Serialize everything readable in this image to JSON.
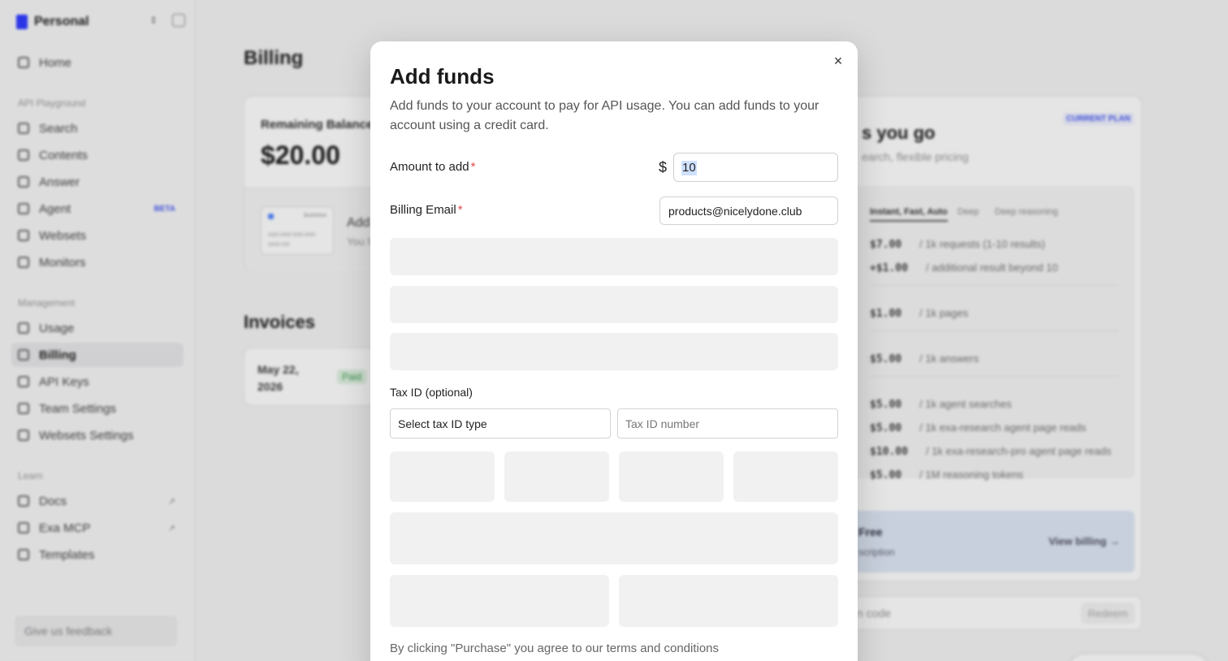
{
  "sidebar": {
    "workspace": "Personal",
    "items": [
      {
        "label": "Home"
      },
      {
        "label": "Search"
      },
      {
        "label": "Contents"
      },
      {
        "label": "Answer"
      },
      {
        "label": "Agent",
        "badge": "BETA"
      },
      {
        "label": "Websets"
      },
      {
        "label": "Monitors"
      },
      {
        "label": "Usage"
      },
      {
        "label": "Billing",
        "active": true
      },
      {
        "label": "API Keys"
      },
      {
        "label": "Team Settings"
      },
      {
        "label": "Websets Settings"
      },
      {
        "label": "Docs",
        "external": "↗"
      },
      {
        "label": "Exa MCP",
        "external": "↗"
      },
      {
        "label": "Templates"
      }
    ],
    "sections": {
      "playground": "API Playground",
      "management": "Management",
      "learn": "Learn"
    },
    "feedback": "Give us feedback"
  },
  "billing": {
    "title": "Billing",
    "balance_label": "Remaining Balance",
    "balance_value": "$20.00",
    "card_brand": "business",
    "card_number": "0000 0000 0000 0000",
    "card_expiry": "00/00 000",
    "add_label": "Add",
    "add_sub": "You h",
    "invoices_title": "Invoices",
    "invoice": {
      "date": "May 22, 2026",
      "status": "Paid"
    }
  },
  "plan": {
    "title": "s you go",
    "subtitle": "earch, flexible pricing",
    "current_plan": "CURRENT PLAN",
    "tabs": [
      "Instant, Fast, Auto",
      "Deep",
      "Deep reasoning"
    ],
    "prices": [
      {
        "amount": "$7.00",
        "desc": "/ 1k requests (1-10 results)"
      },
      {
        "amount": "+$1.00",
        "desc": "/ additional result beyond 10"
      },
      {
        "amount": "$1.00",
        "desc": "/ 1k pages"
      },
      {
        "amount": "$5.00",
        "desc": "/ 1k answers"
      },
      {
        "amount": "$5.00",
        "desc": "/ 1k agent searches"
      },
      {
        "amount": "$5.00",
        "desc": "/ 1k exa-research agent page reads"
      },
      {
        "amount": "$10.00",
        "desc": "/ 1k exa-research-pro agent page reads"
      },
      {
        "amount": "$5.00",
        "desc": "/ 1M reasoning tokens"
      }
    ],
    "free_title": "Free",
    "free_sub": "scription",
    "view_billing": "View billing →",
    "promo_placeholder": "n code",
    "redeem": "Redeem"
  },
  "modal": {
    "title": "Add funds",
    "description": "Add funds to your account to pay for API usage. You can add funds to your account using a credit card.",
    "amount_label": "Amount to add",
    "currency": "$",
    "amount_value": "10",
    "email_label": "Billing Email",
    "email_value": "products@nicelydone.club",
    "required_mark": "*",
    "tax_label": "Tax ID (optional)",
    "tax_type_placeholder": "Select tax ID type",
    "tax_number_placeholder": "Tax ID number",
    "terms": "By clicking \"Purchase\" you agree to our terms and conditions",
    "close_icon": "×"
  }
}
